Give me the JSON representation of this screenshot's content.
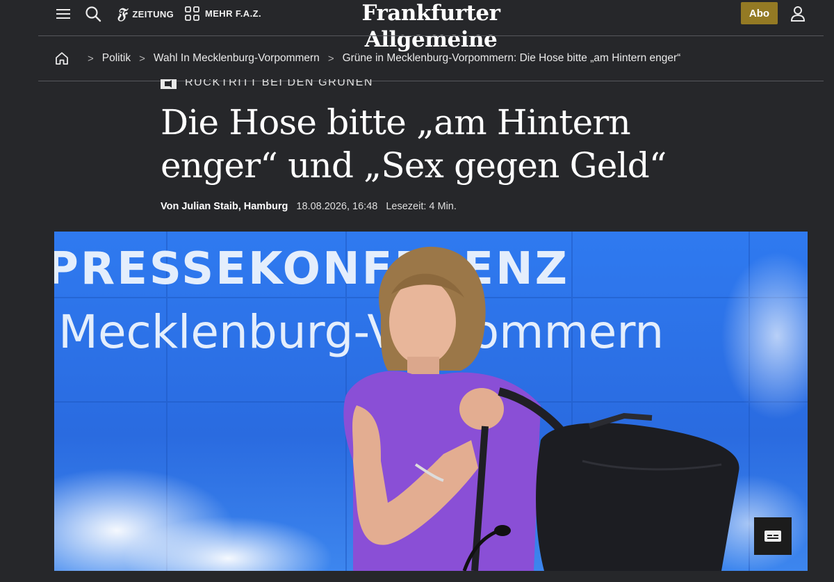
{
  "nav": {
    "zeitung_label": "ZEITUNG",
    "mehr_label": "MEHR F.A.Z.",
    "masthead": "Frankfurter Allgemeine",
    "abo_label": "Abo"
  },
  "breadcrumb": {
    "items": [
      "Politik",
      "Wahl In Mecklenburg-Vorpommern",
      "Grüne in Mecklenburg-Vorpommern: Die Hose bitte „am Hintern enger“"
    ],
    "separator": ">"
  },
  "article": {
    "kicker": "RÜCKTRITT BEI DEN GRÜNEN",
    "headline_line1": "Die Hose bitte „am Hintern",
    "headline_line2": "enger“ und „Sex gegen Geld“",
    "author": "Von Julian Staib, Hamburg",
    "date": "18.08.2026, 16:48",
    "reading_time": "Lesezeit: 4 Min."
  },
  "hero": {
    "backdrop_line1": "PRESSEKONFERENZ",
    "backdrop_line2": "Mecklenburg-Vorpommern"
  },
  "colors": {
    "background": "#26272a",
    "abo": "#947a24",
    "hero_blue": "#2b6ee0",
    "shirt": "#8a4fd6"
  },
  "icons": [
    "menu-icon",
    "search-icon",
    "faz-f-icon",
    "grid-icon",
    "user-icon",
    "home-icon",
    "caption-icon",
    "kicker-badge-icon"
  ]
}
